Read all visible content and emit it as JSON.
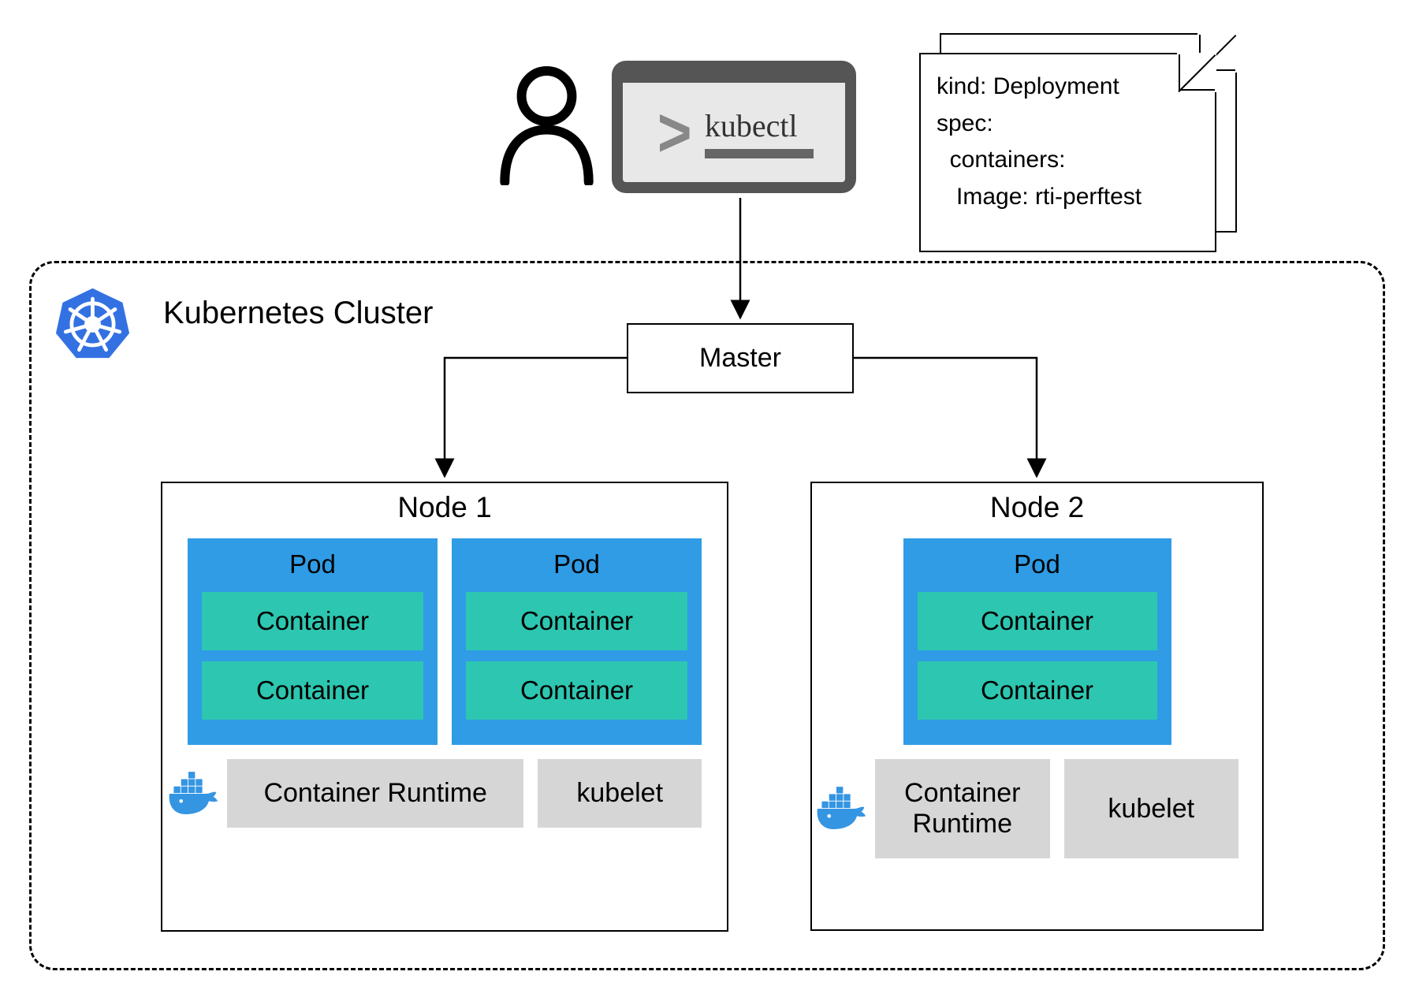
{
  "terminal": {
    "command": "kubectl"
  },
  "yaml": {
    "line1": "kind: Deployment",
    "line2": "spec:",
    "line3": "  containers:",
    "line4": "   Image: rti-perftest"
  },
  "cluster": {
    "title": "Kubernetes Cluster",
    "master": "Master",
    "nodes": [
      {
        "title": "Node 1",
        "pods": [
          {
            "title": "Pod",
            "containers": [
              "Container",
              "Container"
            ]
          },
          {
            "title": "Pod",
            "containers": [
              "Container",
              "Container"
            ]
          }
        ],
        "runtime": "Container Runtime",
        "kubelet": "kubelet"
      },
      {
        "title": "Node 2",
        "pods": [
          {
            "title": "Pod",
            "containers": [
              "Container",
              "Container"
            ]
          }
        ],
        "runtime": "Container Runtime",
        "kubelet": "kubelet"
      }
    ]
  }
}
